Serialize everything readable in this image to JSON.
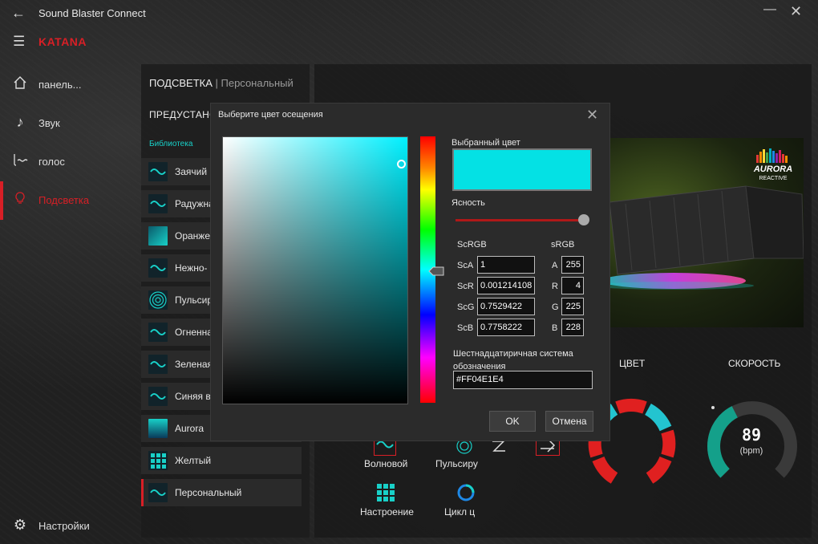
{
  "app": {
    "title": "Sound Blaster Connect",
    "device": "KATANA"
  },
  "nav": {
    "items": [
      {
        "label": "панель..."
      },
      {
        "label": "Звук"
      },
      {
        "label": "голос"
      },
      {
        "label": "Подсветка"
      }
    ],
    "settings_label": "Настройки"
  },
  "section": {
    "title": "ПОДСВЕТКА",
    "separator": " | ",
    "subtitle": "Персональный"
  },
  "presets": {
    "title": "ПРЕДУСТАНО",
    "library_label": "Библиотека",
    "items": [
      {
        "label": "Заячий"
      },
      {
        "label": "Радужна"
      },
      {
        "label": "Оранже"
      },
      {
        "label": "Нежно-"
      },
      {
        "label": "Пульсир"
      },
      {
        "label": "Огненна"
      },
      {
        "label": "Зеленая"
      },
      {
        "label": "Синяя в"
      },
      {
        "label": "Aurora"
      },
      {
        "label": "Желтый"
      },
      {
        "label": "Персональный"
      }
    ]
  },
  "right": {
    "logo_text": "AURORA",
    "logo_sub": "REACTIVE",
    "color_label": "ЦВЕТ",
    "speed_label": "СКОРОСТЬ",
    "speed_value": "89",
    "speed_unit": "(bpm)",
    "speed_fraction": 0.4,
    "effects": [
      {
        "label": "Волновой"
      },
      {
        "label": "Пульсиру"
      },
      {
        "label": "Настроение"
      },
      {
        "label": "Цикл ц"
      }
    ]
  },
  "dialog": {
    "title": "Выберите цвет осещения",
    "selected_color_label": "Выбранный цвет",
    "selected_color": "#04E1E4",
    "clarity_label": "Ясность",
    "clarity_value": 1.0,
    "scrgb_label": "ScRGB",
    "srgb_label": "sRGB",
    "scrgb": [
      {
        "label": "ScA",
        "value": "1"
      },
      {
        "label": "ScR",
        "value": "0.001214108"
      },
      {
        "label": "ScG",
        "value": "0.7529422"
      },
      {
        "label": "ScB",
        "value": "0.7758222"
      }
    ],
    "srgb": [
      {
        "label": "A",
        "value": "255"
      },
      {
        "label": "R",
        "value": "4"
      },
      {
        "label": "G",
        "value": "225"
      },
      {
        "label": "B",
        "value": "228"
      }
    ],
    "hex_label": "Шестнадцатиричная система обозначения",
    "hex_value": "#FF04E1E4",
    "ok_label": "OK",
    "cancel_label": "Отмена"
  },
  "colors": {
    "accent": "#d81f26",
    "teal": "#18d0c8"
  }
}
